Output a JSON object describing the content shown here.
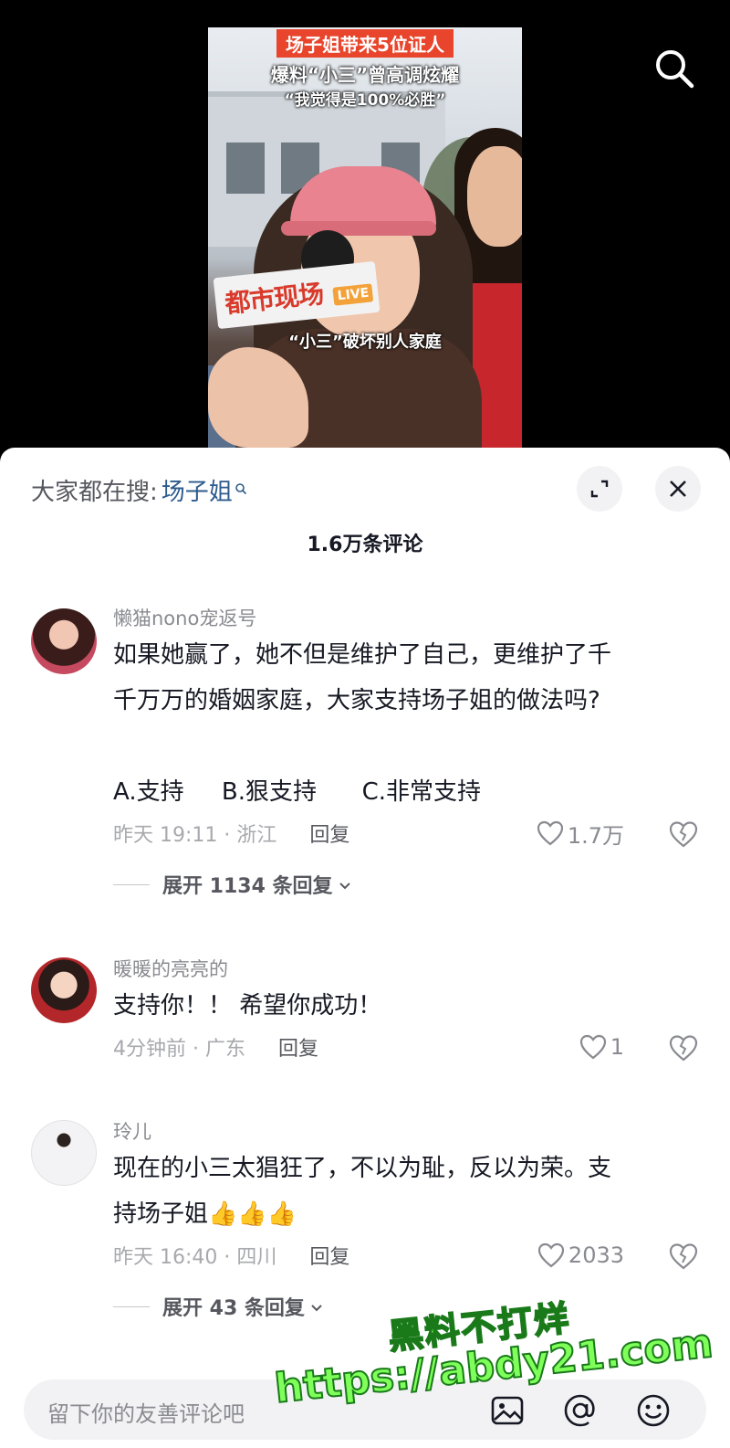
{
  "video": {
    "headline_1": "场子姐带来5位证人",
    "headline_2": "爆料“小三”曾高调炫耀",
    "headline_3": "“我觉得是100%必胜”",
    "mic_brand": "都市现场",
    "mic_live": "LIVE",
    "subtitle": "“小三”破坏别人家庭",
    "search_icon": "search-icon"
  },
  "panel": {
    "hot_label": "大家都在搜:",
    "hot_term": "场子姐",
    "comment_count": "1.6万条评论"
  },
  "comments": [
    {
      "author": "懒猫nono宠返号",
      "lines": [
        "如果她赢了，她不但是维护了自己，更维护了千",
        "千万万的婚姻家庭，大家支持场子姐的做法吗?",
        "",
        "A.支持     B.狠支持      C.非常支持"
      ],
      "time_loc": "昨天 19:11 · 浙江",
      "reply": "回复",
      "likes": "1.7万",
      "expand": "展开 1134 条回复"
    },
    {
      "author": "暖暖的亮亮的",
      "lines": [
        "支持你！！ 希望你成功！"
      ],
      "time_loc": "4分钟前 · 广东",
      "reply": "回复",
      "likes": "1"
    },
    {
      "author": "玲儿",
      "lines": [
        "现在的小三太猖狂了，不以为耻，反以为荣。支",
        "持场子姐👍👍👍"
      ],
      "time_loc": "昨天 16:40 · 四川",
      "reply": "回复",
      "likes": "2033",
      "expand": "展开 43 条回复"
    }
  ],
  "input": {
    "placeholder": "留下你的友善评论吧"
  },
  "watermark": {
    "line1": "黑料不打烊",
    "line2": "https://abdy21.com"
  }
}
